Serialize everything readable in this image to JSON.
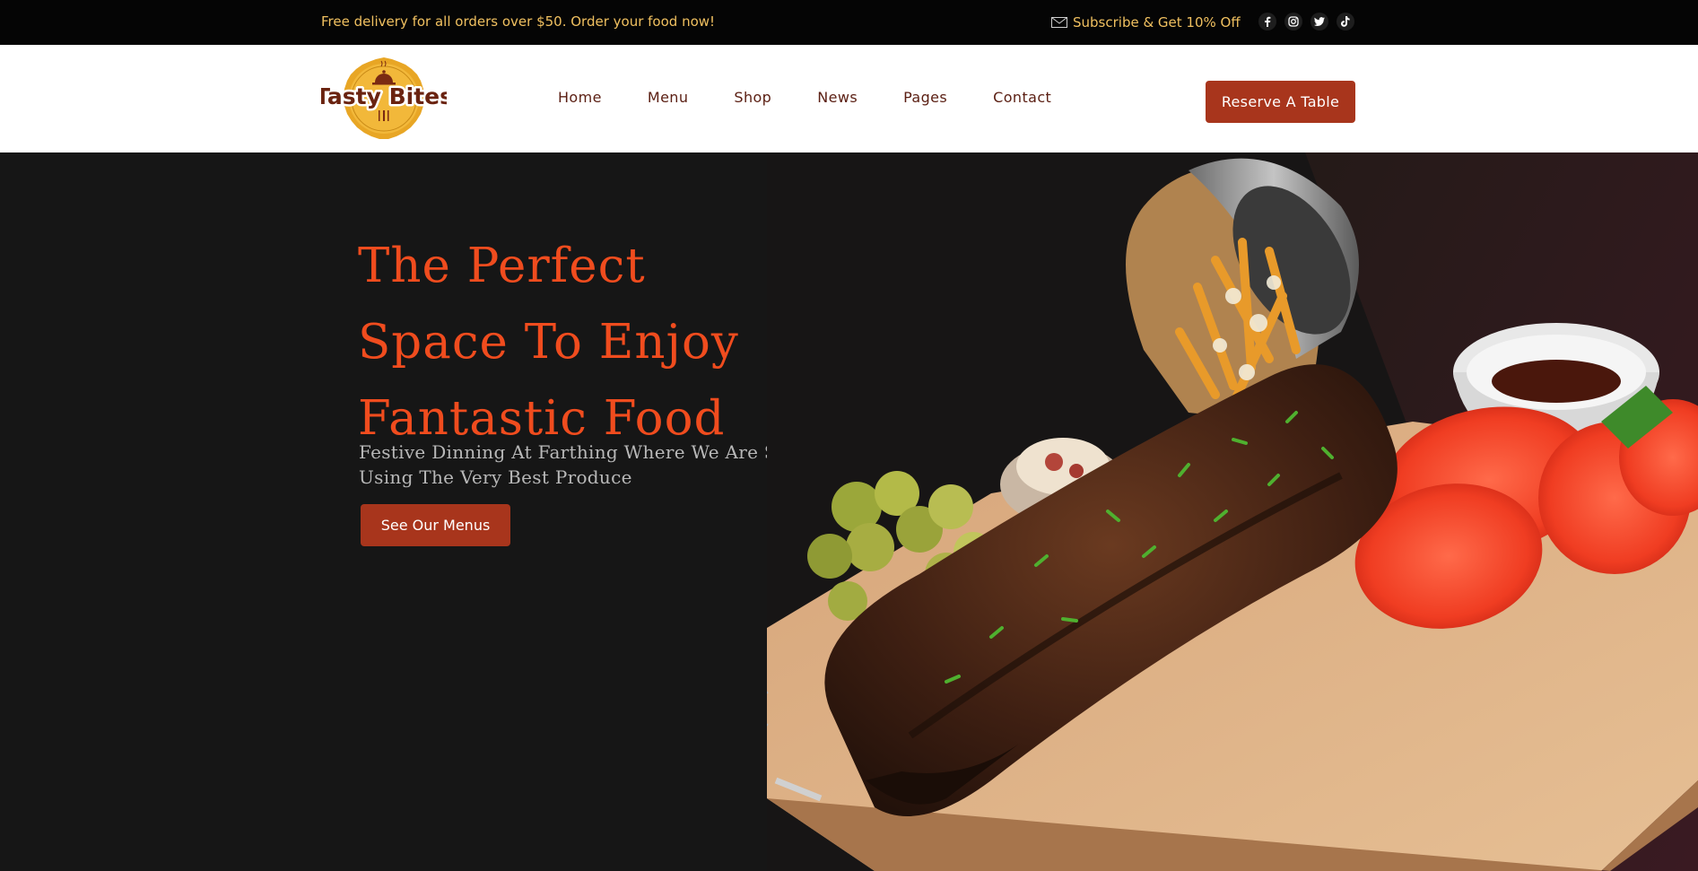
{
  "topbar": {
    "promo_text": "Free delivery for all orders over $50. Order your food now!",
    "subscribe_text": "Subscribe & Get 10% Off",
    "mail_icon": "mail-icon",
    "socials": [
      "facebook-icon",
      "instagram-icon",
      "twitter-icon",
      "tiktok-icon"
    ]
  },
  "header": {
    "logo_text": "Tasty Bites",
    "nav": [
      "Home",
      "Menu",
      "Shop",
      "News",
      "Pages",
      "Contact"
    ],
    "reserve_label": "Reserve A Table"
  },
  "hero": {
    "title_lines": [
      "The Perfect",
      "Space To Enjoy",
      "Fantastic Food"
    ],
    "subtitle": "Festive Dinning At Farthing Where We Are Strong Belivers In Using The Very Best Produce",
    "cta_label": "See Our Menus"
  },
  "colors": {
    "accent": "#a8351c",
    "title_orange": "#f04c1e",
    "topbar_text": "#f0c060",
    "nav_text": "#5a1e12",
    "hero_bg": "#161616"
  }
}
